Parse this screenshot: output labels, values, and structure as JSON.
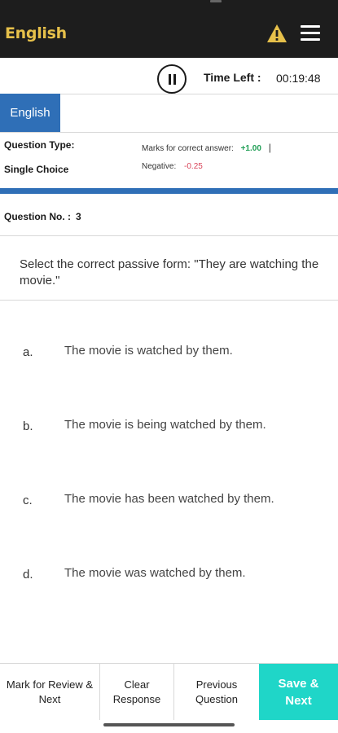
{
  "header": {
    "title": "English",
    "warning_icon": "warning-triangle-icon",
    "menu_icon": "hamburger-menu-icon",
    "accent": "#e6c04a"
  },
  "timer": {
    "label": "Time Left :",
    "value": "00:19:48",
    "pause_icon": "pause-icon"
  },
  "language_tab": {
    "label": "English",
    "color": "#2f6fb7"
  },
  "question_info": {
    "type_label": "Question Type:",
    "type_value": "Single Choice",
    "marks_label": "Marks for correct answer:",
    "marks_value": "+1.00",
    "separator": "|",
    "negative_label": "Negative:",
    "negative_value": "-0.25"
  },
  "question_number": {
    "label": "Question No. :",
    "value": "3"
  },
  "question_text": "Select the correct passive form: \"They are watching the movie.\"",
  "options": [
    {
      "letter": "a.",
      "text": "The movie is watched by them."
    },
    {
      "letter": "b.",
      "text": "The movie is being watched by them."
    },
    {
      "letter": "c.",
      "text": "The movie has been watched by them."
    },
    {
      "letter": "d.",
      "text": "The movie was watched by them."
    }
  ],
  "footer": {
    "mark_review": "Mark for Review & Next",
    "clear": "Clear Response",
    "previous": "Previous Question",
    "save_next": "Save & Next",
    "save_color": "#1fd6c8"
  }
}
